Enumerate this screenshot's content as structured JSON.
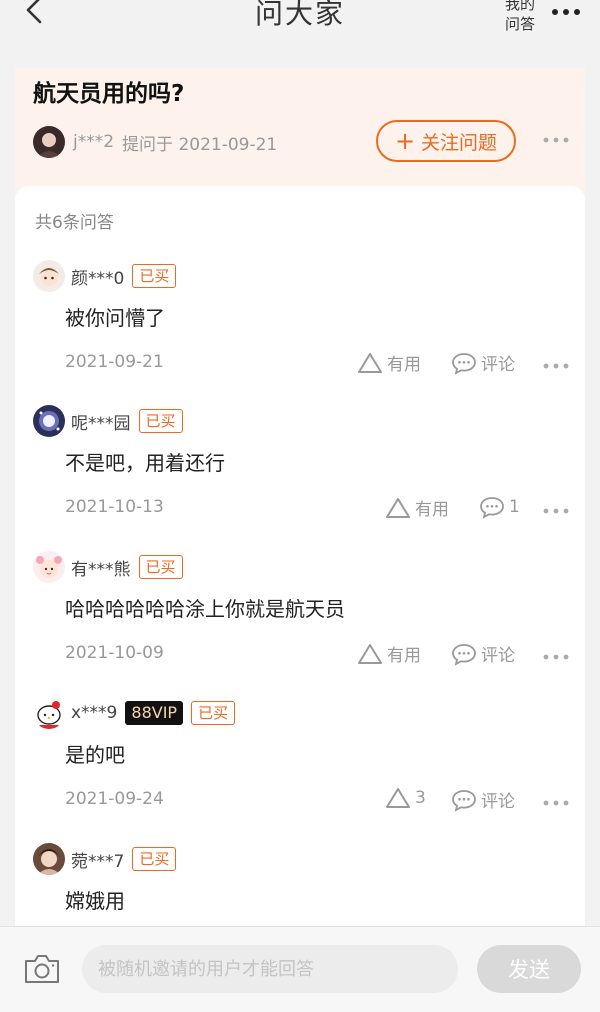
{
  "header": {
    "title": "问大家",
    "my_answers": "我的问答"
  },
  "question": {
    "title": "航天员用的吗?",
    "asker_name": "j***2",
    "asker_time": "提问于 2021-09-21",
    "follow_label": "关注问题"
  },
  "answers_count": "共6条问答",
  "answers": [
    {
      "user": "颜***0",
      "badge": "已买",
      "text": "被你问懵了",
      "date": "2021-09-21",
      "useful": "有用",
      "comment": "评论"
    },
    {
      "user": "呢***园",
      "badge": "已买",
      "text": "不是吧，用着还行",
      "date": "2021-10-13",
      "useful": "有用",
      "comment": "1"
    },
    {
      "user": "有***熊",
      "badge": "已买",
      "text": "哈哈哈哈哈哈涂上你就是航天员",
      "date": "2021-10-09",
      "useful": "有用",
      "comment": "评论"
    },
    {
      "user": "x***9",
      "vip": "88VIP",
      "badge": "已买",
      "text": "是的吧",
      "date": "2021-09-24",
      "useful": "3",
      "comment": "评论"
    },
    {
      "user": "菀***7",
      "badge": "已买",
      "text": "嫦娥用"
    }
  ],
  "composer": {
    "placeholder": "被随机邀请的用户才能回答",
    "send_label": "发送"
  },
  "colors": {
    "accent": "#f06820",
    "question_bg": "#fdf3ec",
    "page_bg": "#f2f2f2"
  }
}
